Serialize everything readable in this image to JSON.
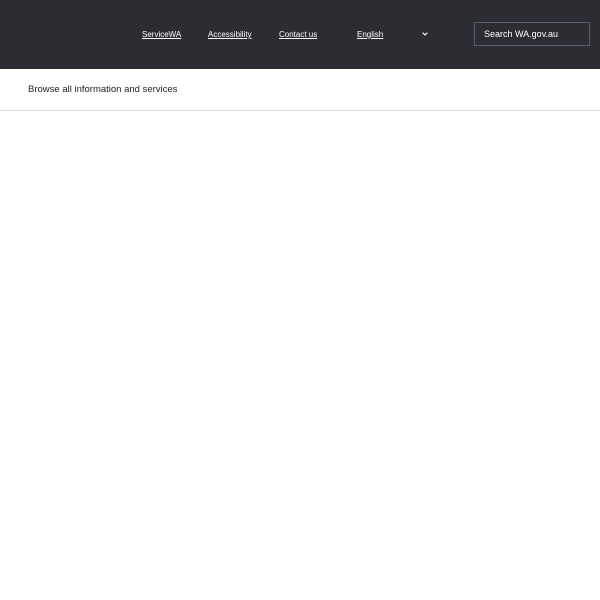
{
  "header": {
    "nav": {
      "servicewa": "ServiceWA",
      "accessibility": "Accessibility",
      "contact": "Contact us"
    },
    "language": {
      "selected": "English"
    },
    "search": {
      "placeholder": "Search WA.gov.au"
    }
  },
  "browse": {
    "label": "Browse all information and services"
  },
  "icons": {
    "language_dropdown": "chevron-down-icon"
  },
  "colors": {
    "header_bg": "#2b2d33",
    "header_text": "#ffffff",
    "body_bg": "#ffffff",
    "body_text": "#222222"
  }
}
